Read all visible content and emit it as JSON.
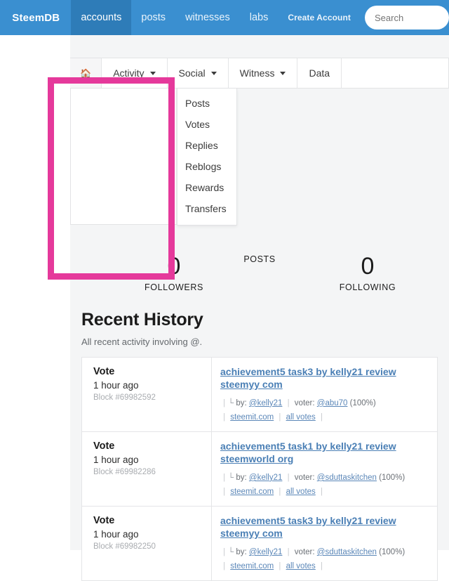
{
  "navbar": {
    "brand": "SteemDB",
    "items": [
      {
        "label": "accounts",
        "active": true
      },
      {
        "label": "posts",
        "active": false
      },
      {
        "label": "witnesses",
        "active": false
      },
      {
        "label": "labs",
        "active": false
      }
    ],
    "create_account": "Create Account",
    "search_placeholder": "Search"
  },
  "tabs": {
    "home_icon": "home-icon",
    "items": [
      {
        "label": "Activity",
        "has_caret": true
      },
      {
        "label": "Social",
        "has_caret": true
      },
      {
        "label": "Witness",
        "has_caret": true
      },
      {
        "label": "Data",
        "has_caret": false
      }
    ]
  },
  "dropdown": {
    "open_for": "Activity",
    "items": [
      "Posts",
      "Votes",
      "Replies",
      "Reblogs",
      "Rewards",
      "Transfers"
    ]
  },
  "highlight": {
    "color": "#e5399b"
  },
  "stats": {
    "followers": {
      "value": "0",
      "label": "FOLLOWERS"
    },
    "posts": {
      "value": "",
      "label": "POSTS"
    },
    "following": {
      "value": "0",
      "label": "FOLLOWING"
    }
  },
  "history": {
    "title": "Recent History",
    "subtitle": "All recent activity involving @.",
    "rows": [
      {
        "type": "Vote",
        "time": "1 hour ago",
        "block": "Block #69982592",
        "link": "achievement5 task3 by kelly21 review steemyy com",
        "corner": "└",
        "by_label": "by:",
        "by_user": "@kelly21",
        "voter_label": "voter:",
        "voter_user": "@abu70",
        "weight": "(100%)",
        "source": "steemit.com",
        "all_votes": "all votes"
      },
      {
        "type": "Vote",
        "time": "1 hour ago",
        "block": "Block #69982286",
        "link": "achievement5 task1 by kelly21 review steemworld org",
        "corner": "└",
        "by_label": "by:",
        "by_user": "@kelly21",
        "voter_label": "voter:",
        "voter_user": "@sduttaskitchen",
        "weight": "(100%)",
        "source": "steemit.com",
        "all_votes": "all votes"
      },
      {
        "type": "Vote",
        "time": "1 hour ago",
        "block": "Block #69982250",
        "link": "achievement5 task3 by kelly21 review steemyy com",
        "corner": "└",
        "by_label": "by:",
        "by_user": "@kelly21",
        "voter_label": "voter:",
        "voter_user": "@sduttaskitchen",
        "weight": "(100%)",
        "source": "steemit.com",
        "all_votes": "all votes"
      }
    ]
  }
}
